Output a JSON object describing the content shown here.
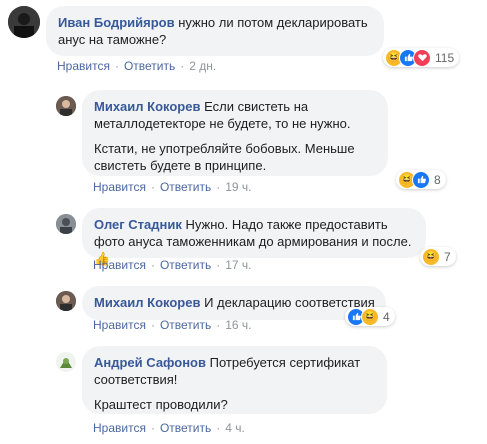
{
  "comments": [
    {
      "author": "Иван Бодрийяров",
      "text": "нужно ли потом декларировать анус на таможне?",
      "like": "Нравится",
      "reply": "Ответить",
      "time": "2 дн.",
      "reactions": [
        "haha",
        "like",
        "love"
      ],
      "reaction_count": "115"
    },
    {
      "author": "Михаил Кокорев",
      "text": "Если свистеть на металлодетекторе не будете, то не нужно.",
      "text2": "Кстати, не употребляйте бобовых. Меньше свистеть будете в принципе.",
      "like": "Нравится",
      "reply": "Ответить",
      "time": "19 ч.",
      "reactions": [
        "haha",
        "like"
      ],
      "reaction_count": "8"
    },
    {
      "author": "Олег Стадник",
      "text": "Нужно. Надо также предоставить фото ануса таможенникам до армирования и после.",
      "emoji": "👍",
      "like": "Нравится",
      "reply": "Ответить",
      "time": "17 ч.",
      "reactions": [
        "haha"
      ],
      "reaction_count": "7"
    },
    {
      "author": "Михаил Кокорев",
      "text": "И декларацию соответствия",
      "like": "Нравится",
      "reply": "Ответить",
      "time": "16 ч.",
      "reactions": [
        "like",
        "haha"
      ],
      "reaction_count": "4"
    },
    {
      "author": "Андрей Сафонов",
      "text": "Потребуется сертификат соответствия!",
      "text2": "Краштест проводили?",
      "like": "Нравится",
      "reply": "Ответить",
      "time": "4 ч."
    }
  ],
  "colors": {
    "author": "#385898",
    "bubble": "#f2f3f5",
    "link": "#4b67a1"
  }
}
